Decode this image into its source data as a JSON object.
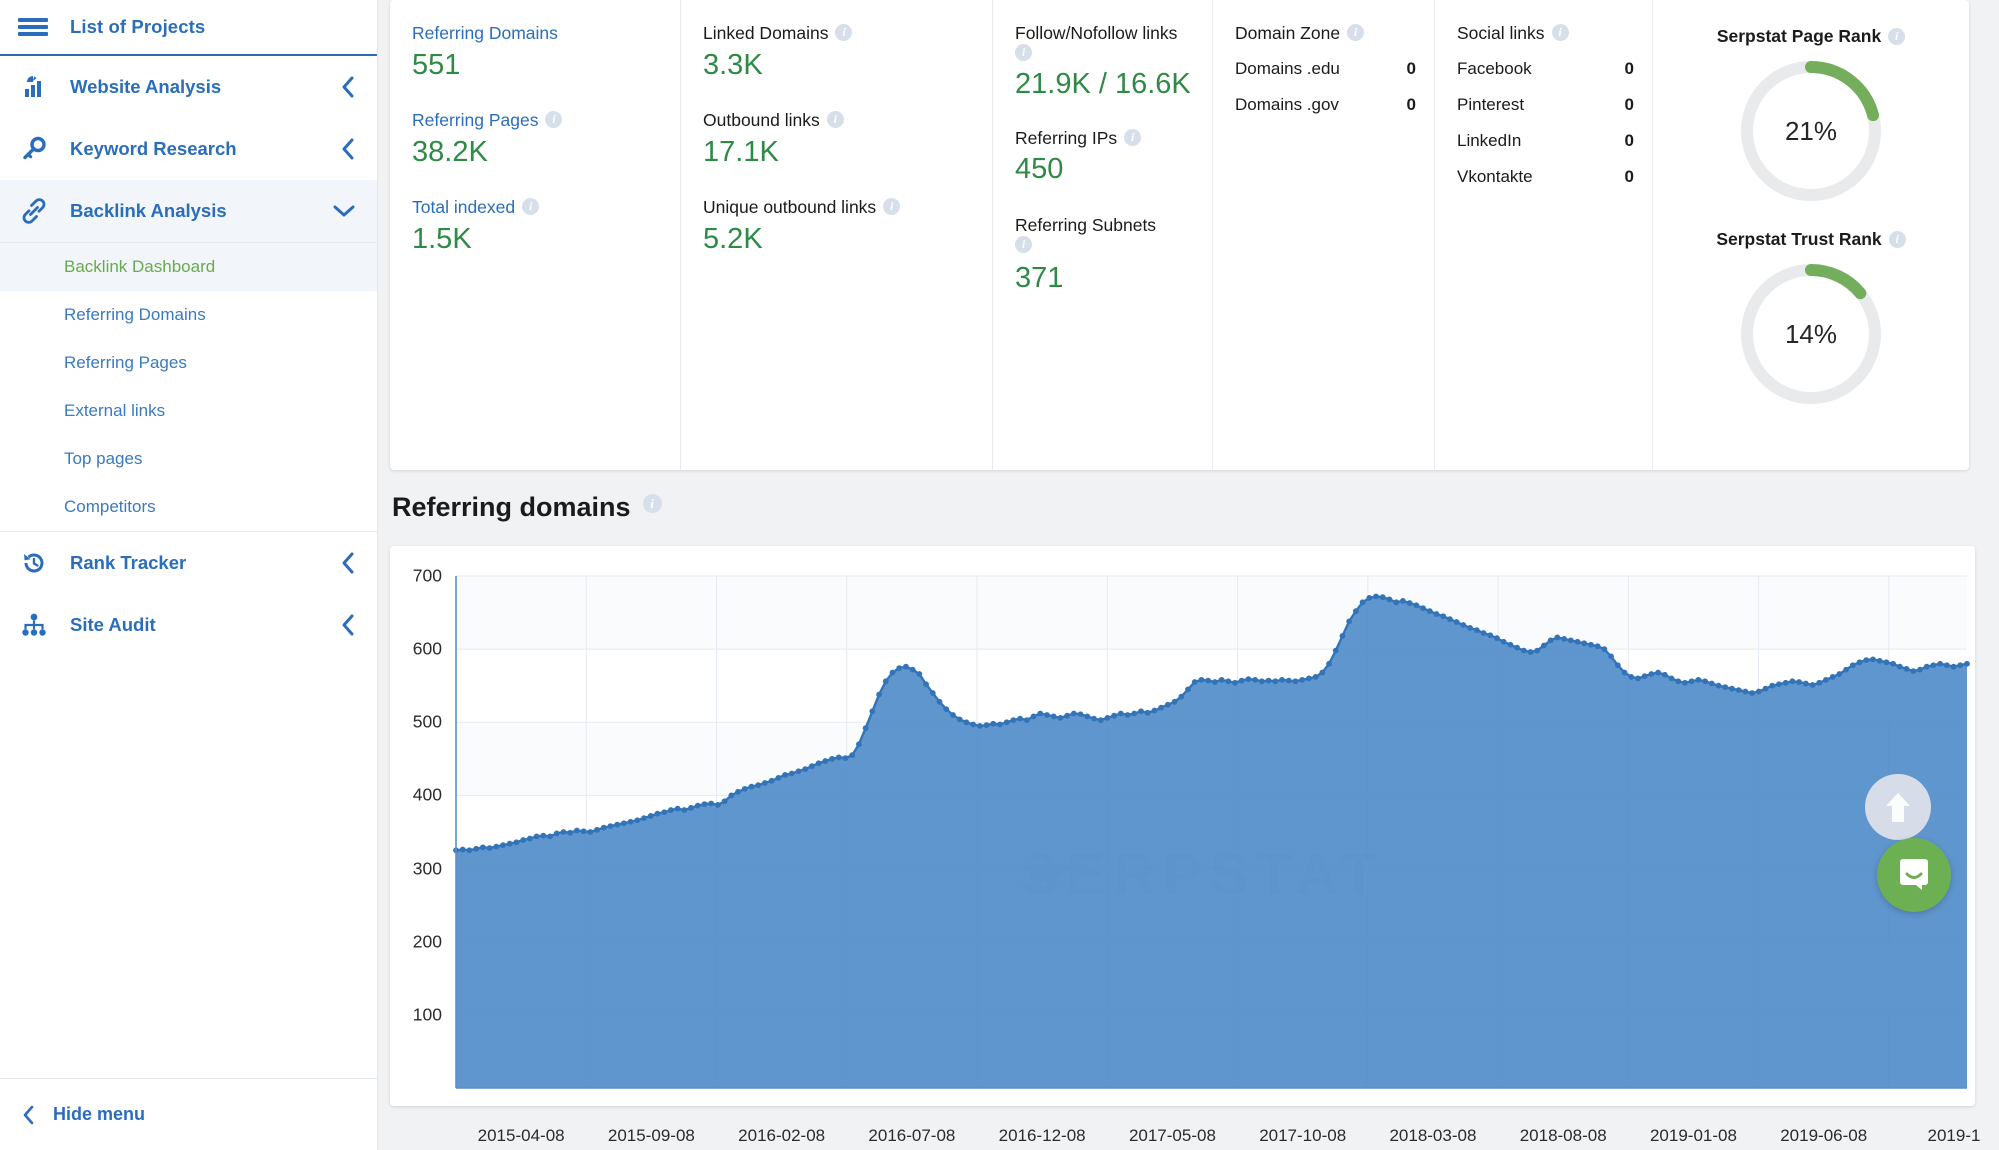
{
  "sidebar": {
    "top": {
      "label": "List of Projects",
      "icon": "hamburger-icon"
    },
    "items": [
      {
        "label": "Website Analysis",
        "icon": "analytics-icon",
        "chevron": "chevron-left"
      },
      {
        "label": "Keyword Research",
        "icon": "key-icon",
        "chevron": "chevron-left"
      },
      {
        "label": "Backlink Analysis",
        "icon": "link-icon",
        "chevron": "chevron-down",
        "active": true
      },
      {
        "label": "Rank Tracker",
        "icon": "history-icon",
        "chevron": "chevron-left"
      },
      {
        "label": "Site Audit",
        "icon": "sitemap-icon",
        "chevron": "chevron-left"
      }
    ],
    "subitems": [
      {
        "label": "Backlink Dashboard",
        "current": true
      },
      {
        "label": "Referring Domains",
        "current": false
      },
      {
        "label": "Referring Pages",
        "current": false
      },
      {
        "label": "External links",
        "current": false
      },
      {
        "label": "Top pages",
        "current": false
      },
      {
        "label": "Competitors",
        "current": false
      }
    ],
    "hide_menu": {
      "label": "Hide menu",
      "icon": "chevron-left-icon"
    }
  },
  "kpi": {
    "col1": [
      {
        "label": "Referring Domains",
        "value": "551",
        "link": true,
        "info": false
      },
      {
        "label": "Referring Pages",
        "value": "38.2K",
        "link": true,
        "info": true
      },
      {
        "label": "Total indexed",
        "value": "1.5K",
        "link": true,
        "info": true
      }
    ],
    "col2": [
      {
        "label": "Linked Domains",
        "value": "3.3K",
        "link": false,
        "info": true
      },
      {
        "label": "Outbound links",
        "value": "17.1K",
        "link": false,
        "info": true
      },
      {
        "label": "Unique outbound links",
        "value": "5.2K",
        "link": false,
        "info": true
      }
    ],
    "col3": [
      {
        "label": "Follow/Nofollow links",
        "value": "21.9K / 16.6K",
        "link": false,
        "info": true,
        "info_below": true
      },
      {
        "label": "Referring IPs",
        "value": "450",
        "link": false,
        "info": true
      },
      {
        "label": "Referring Subnets",
        "value": "371",
        "link": false,
        "info": true,
        "info_below": true
      }
    ],
    "domain_zone": {
      "title": "Domain Zone",
      "rows": [
        {
          "label": "Domains .edu",
          "value": "0"
        },
        {
          "label": "Domains .gov",
          "value": "0"
        }
      ]
    },
    "social_links": {
      "title": "Social links",
      "rows": [
        {
          "label": "Facebook",
          "value": "0"
        },
        {
          "label": "Pinterest",
          "value": "0"
        },
        {
          "label": "LinkedIn",
          "value": "0"
        },
        {
          "label": "Vkontakte",
          "value": "0"
        }
      ]
    },
    "gauges": [
      {
        "title": "Serpstat Page Rank",
        "value": "21%",
        "percent": 21
      },
      {
        "title": "Serpstat Trust Rank",
        "value": "14%",
        "percent": 14
      }
    ]
  },
  "chart_section": {
    "title": "Referring domains",
    "watermark": "SERPSTAT"
  },
  "chart_data": {
    "type": "area",
    "title": "Referring domains",
    "xlabel": "",
    "ylabel": "",
    "ylim": [
      0,
      700
    ],
    "yticks": [
      100,
      200,
      300,
      400,
      500,
      600,
      700
    ],
    "grid": true,
    "legend": "none",
    "xtick_labels": [
      "2015-04-08",
      "2015-09-08",
      "2016-02-08",
      "2016-07-08",
      "2016-12-08",
      "2017-05-08",
      "2017-10-08",
      "2018-03-08",
      "2018-08-08",
      "2019-01-08",
      "2019-06-08",
      "2019-1"
    ],
    "series": [
      {
        "name": "Referring domains",
        "color": "#4a87c7",
        "values": [
          325,
          326,
          325,
          327,
          329,
          328,
          330,
          332,
          334,
          336,
          339,
          341,
          344,
          345,
          344,
          348,
          350,
          349,
          352,
          351,
          350,
          353,
          356,
          358,
          360,
          362,
          364,
          366,
          369,
          372,
          375,
          377,
          380,
          382,
          380,
          383,
          386,
          388,
          389,
          387,
          392,
          400,
          405,
          409,
          412,
          414,
          417,
          420,
          424,
          428,
          430,
          433,
          436,
          440,
          444,
          447,
          450,
          452,
          451,
          455,
          470,
          492,
          515,
          538,
          556,
          568,
          574,
          576,
          572,
          566,
          552,
          540,
          528,
          518,
          510,
          504,
          500,
          497,
          495,
          496,
          498,
          497,
          500,
          503,
          505,
          503,
          508,
          512,
          510,
          508,
          506,
          509,
          512,
          511,
          508,
          505,
          503,
          506,
          509,
          512,
          510,
          512,
          515,
          513,
          516,
          520,
          524,
          528,
          535,
          545,
          555,
          558,
          557,
          555,
          558,
          556,
          554,
          557,
          559,
          558,
          556,
          557,
          556,
          558,
          557,
          556,
          558,
          560,
          562,
          568,
          580,
          598,
          618,
          638,
          652,
          664,
          670,
          672,
          671,
          668,
          664,
          666,
          663,
          660,
          656,
          652,
          648,
          645,
          641,
          637,
          633,
          629,
          626,
          622,
          619,
          615,
          610,
          606,
          602,
          598,
          596,
          598,
          605,
          612,
          616,
          614,
          612,
          610,
          608,
          606,
          604,
          600,
          590,
          578,
          568,
          562,
          560,
          563,
          566,
          568,
          565,
          560,
          556,
          554,
          556,
          558,
          556,
          553,
          550,
          548,
          546,
          544,
          542,
          540,
          542,
          546,
          550,
          552,
          554,
          556,
          555,
          553,
          551,
          554,
          558,
          562,
          566,
          572,
          578,
          582,
          585,
          586,
          584,
          582,
          580,
          576,
          573,
          570,
          572,
          576,
          578,
          580,
          578,
          576,
          578,
          580
        ]
      }
    ]
  },
  "fab": {
    "scroll_top": "scroll-to-top",
    "chat": "chat-bubble"
  }
}
